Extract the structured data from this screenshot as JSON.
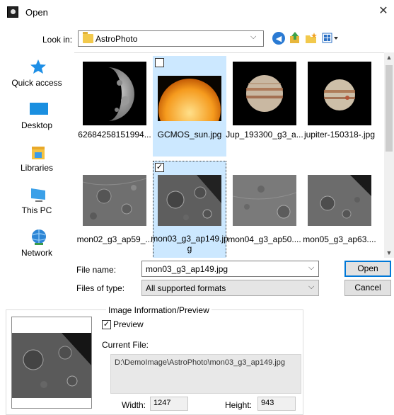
{
  "window": {
    "title": "Open",
    "close_glyph": "✕"
  },
  "look_in": {
    "label": "Look in:",
    "value": "AstroPhoto"
  },
  "toolbar": {
    "icons": [
      "back-icon",
      "up-folder-icon",
      "new-folder-icon",
      "view-menu-icon"
    ]
  },
  "sidebar": {
    "items": [
      {
        "label": "Quick access",
        "icon": "quick-access-icon"
      },
      {
        "label": "Desktop",
        "icon": "desktop-icon"
      },
      {
        "label": "Libraries",
        "icon": "libraries-icon"
      },
      {
        "label": "This PC",
        "icon": "this-pc-icon"
      },
      {
        "label": "Network",
        "icon": "network-icon"
      }
    ]
  },
  "files": [
    {
      "name": "62684258151994...",
      "kind": "moon-half",
      "selected": false,
      "checked": false
    },
    {
      "name": "GCMOS_sun.jpg",
      "kind": "sun",
      "selected": true,
      "checked": false
    },
    {
      "name": "Jup_193300_g3_a...",
      "kind": "jupiter",
      "selected": false,
      "checked": false
    },
    {
      "name": "jupiter-150318-.jpg",
      "kind": "jupiter",
      "selected": false,
      "checked": false
    },
    {
      "name": "mon02_g3_ap59_...",
      "kind": "crater",
      "selected": false,
      "checked": false
    },
    {
      "name": "mon03_g3_ap149.jpg",
      "kind": "crater",
      "selected": true,
      "checked": true
    },
    {
      "name": "mon04_g3_ap50....",
      "kind": "crater",
      "selected": false,
      "checked": false
    },
    {
      "name": "mon05_g3_ap63....",
      "kind": "crater",
      "selected": false,
      "checked": false
    }
  ],
  "file_name": {
    "label": "File name:",
    "value": "mon03_g3_ap149.jpg"
  },
  "file_type": {
    "label": "Files of type:",
    "value": "All supported formats"
  },
  "buttons": {
    "open": "Open",
    "cancel": "Cancel"
  },
  "info": {
    "group_label": "Image Information/Preview",
    "preview_label": "Preview",
    "preview_checked": true,
    "current_file_label": "Current File:",
    "current_file_path": "D:\\DemoImage\\AstroPhoto\\mon03_g3_ap149.jpg",
    "width_label": "Width:",
    "width_value": "1247",
    "height_label": "Height:",
    "height_value": "943"
  },
  "colors": {
    "selection": "#cce8ff",
    "accent": "#0078d7"
  }
}
